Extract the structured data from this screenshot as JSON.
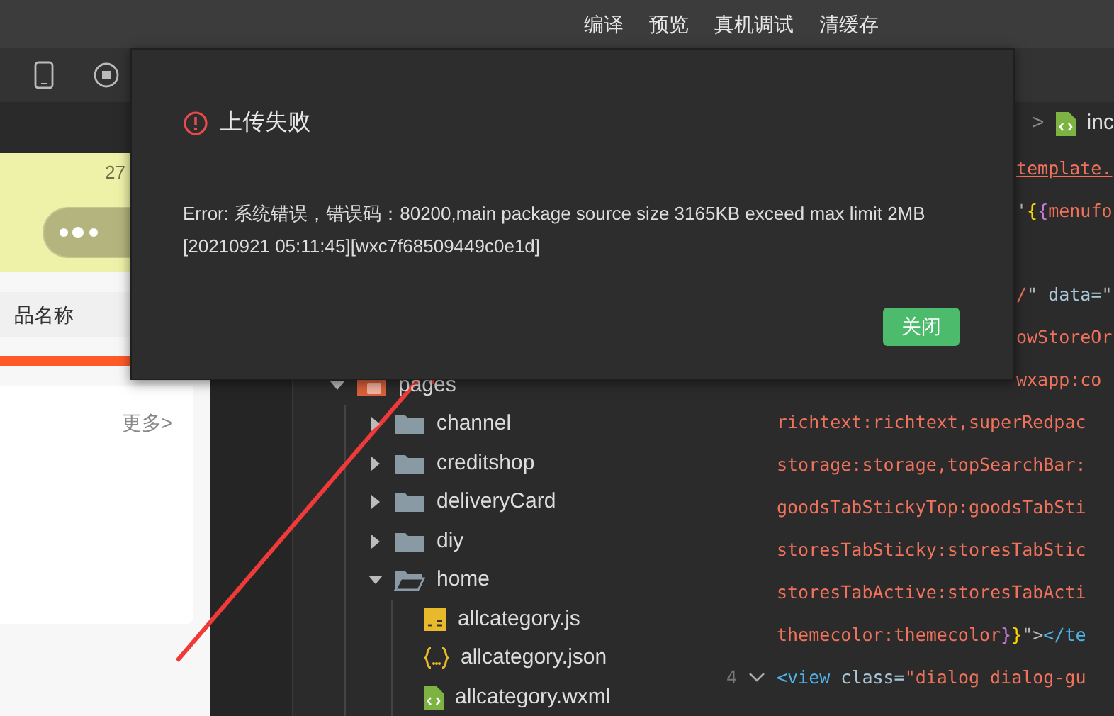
{
  "toolbar": {
    "actions": [
      "编译",
      "预览",
      "真机调试",
      "清缓存"
    ]
  },
  "simulator": {
    "status_time": "27",
    "search": {
      "placeholder": "品名称"
    },
    "more_link": "更多>"
  },
  "file_tree": [
    {
      "name": "pages",
      "kind": "pages-folder",
      "expanded": true,
      "children": [
        {
          "name": "channel",
          "kind": "folder",
          "expanded": false
        },
        {
          "name": "creditshop",
          "kind": "folder",
          "expanded": false
        },
        {
          "name": "deliveryCard",
          "kind": "folder",
          "expanded": false
        },
        {
          "name": "diy",
          "kind": "folder",
          "expanded": false
        },
        {
          "name": "home",
          "kind": "folder",
          "expanded": true,
          "children": [
            {
              "name": "allcategory.js",
              "kind": "js"
            },
            {
              "name": "allcategory.json",
              "kind": "json"
            },
            {
              "name": "allcategory.wxml",
              "kind": "wxml"
            }
          ]
        }
      ]
    }
  ],
  "editor": {
    "breadcrumb": {
      "separator": ">",
      "file": "inc"
    },
    "lines": [
      {
        "clipped": true,
        "tokens": [
          {
            "text": "template.",
            "kind": "error"
          }
        ]
      },
      {
        "clipped": true,
        "tokens": [
          {
            "text": "'",
            "kind": "punct"
          },
          {
            "text": "{",
            "kind": "brace"
          },
          {
            "text": "{",
            "kind": "brace2"
          },
          {
            "text": "menufo",
            "kind": "string"
          }
        ]
      },
      {
        "clipped": true,
        "tokens": [
          {
            "text": "/",
            "kind": "string"
          },
          {
            "text": "\"",
            "kind": "punct"
          },
          {
            "text": " data=",
            "kind": "attr"
          },
          {
            "text": "\"",
            "kind": "punct"
          }
        ]
      },
      {
        "clipped": true,
        "tokens": [
          {
            "text": "owStoreOr",
            "kind": "string"
          }
        ]
      },
      {
        "clipped": true,
        "tokens": [
          {
            "text": "wxapp:co",
            "kind": "string"
          }
        ]
      },
      {
        "clipped": false,
        "tokens": [
          {
            "text": "richtext:richtext,superRedpac",
            "kind": "string"
          }
        ]
      },
      {
        "clipped": false,
        "tokens": [
          {
            "text": "storage:storage,topSearchBar:",
            "kind": "string"
          }
        ]
      },
      {
        "clipped": false,
        "tokens": [
          {
            "text": "goodsTabStickyTop:goodsTabSti",
            "kind": "string"
          }
        ]
      },
      {
        "clipped": false,
        "tokens": [
          {
            "text": "storesTabSticky:storesTabStic",
            "kind": "string"
          }
        ]
      },
      {
        "clipped": false,
        "tokens": [
          {
            "text": "storesTabActive:storesTabActi",
            "kind": "string"
          }
        ]
      },
      {
        "clipped": false,
        "tokens": [
          {
            "text": "themecolor:themecolor",
            "kind": "string"
          },
          {
            "text": "}",
            "kind": "brace2"
          },
          {
            "text": "}",
            "kind": "brace"
          },
          {
            "text": "\">",
            "kind": "punct"
          },
          {
            "text": "</te",
            "kind": "tag"
          }
        ]
      },
      {
        "clipped": false,
        "number": "4",
        "foldable": true,
        "tokens": [
          {
            "text": "<view",
            "kind": "tag"
          },
          {
            "text": " class=",
            "kind": "attr"
          },
          {
            "text": "\"dialog dialog-gu",
            "kind": "string"
          }
        ]
      }
    ]
  },
  "dialog": {
    "title": "上传失败",
    "message": [
      "Error: 系统错误，错误码：80200,main package source size 3165KB exceed max limit 2MB",
      "[20210921 05:11:45][wxc7f68509449c0e1d]"
    ],
    "buttons": [
      "关闭"
    ]
  }
}
